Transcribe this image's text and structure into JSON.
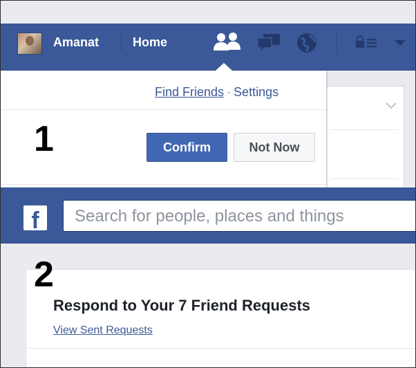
{
  "panel1": {
    "step_number": "1",
    "nav": {
      "user_name": "Amanat",
      "home_label": "Home"
    },
    "icons": {
      "friends": "friend-requests-icon",
      "messages": "messages-icon",
      "notifications": "notifications-globe-icon",
      "privacy": "privacy-shortcuts-icon",
      "account": "account-menu-caret-icon"
    },
    "dropdown": {
      "find_friends_link": "Find Friends",
      "separator": "·",
      "settings_link": "Settings",
      "confirm_button": "Confirm",
      "not_now_button": "Not Now"
    }
  },
  "panel2": {
    "step_number": "2",
    "logo_letter": "f",
    "search": {
      "placeholder": "Search for people, places and things"
    },
    "card": {
      "title": "Respond to Your 7 Friend Requests",
      "view_sent_link": "View Sent Requests"
    }
  },
  "colors": {
    "facebook_blue": "#3b5998",
    "button_blue": "#4267b2",
    "page_background": "#e9ebee"
  }
}
